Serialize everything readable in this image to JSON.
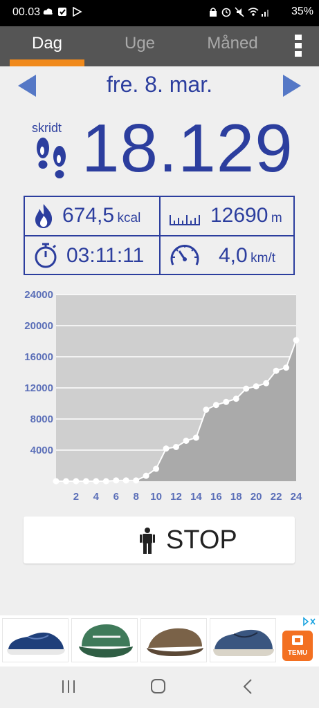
{
  "status_bar": {
    "time": "00.03",
    "battery": "35%"
  },
  "tabs": [
    {
      "label": "Dag",
      "active": true
    },
    {
      "label": "Uge",
      "active": false
    },
    {
      "label": "Måned",
      "active": false
    }
  ],
  "date": "fre. 8. mar.",
  "steps": {
    "label": "skridt",
    "value": "18.129"
  },
  "stats": {
    "calories": {
      "value": "674,5",
      "unit": "kcal"
    },
    "distance": {
      "value": "12690",
      "unit": "m"
    },
    "duration": {
      "value": "03:11:11"
    },
    "speed": {
      "value": "4,0",
      "unit": "km/t"
    }
  },
  "chart_data": {
    "type": "area",
    "ylim": [
      0,
      24000
    ],
    "xlim": [
      0,
      24
    ],
    "y_ticks": [
      "24000",
      "20000",
      "16000",
      "12000",
      "8000",
      "4000"
    ],
    "x_ticks": [
      "2",
      "4",
      "6",
      "8",
      "10",
      "12",
      "14",
      "16",
      "18",
      "20",
      "22",
      "24"
    ],
    "grid": true,
    "x": [
      0,
      1,
      2,
      3,
      4,
      5,
      6,
      7,
      8,
      9,
      10,
      11,
      12,
      13,
      14,
      15,
      16,
      17,
      18,
      19,
      20,
      21,
      22,
      23,
      24
    ],
    "values": [
      0,
      0,
      0,
      0,
      0,
      0,
      100,
      100,
      100,
      700,
      1600,
      4200,
      4400,
      5200,
      5600,
      9200,
      9800,
      10200,
      10600,
      11900,
      12200,
      12600,
      14200,
      14600,
      18129
    ],
    "colors": {
      "fill": "#aaaaaa",
      "background": "#cfcfcf",
      "line": "#ffffff",
      "points": "#ffffff",
      "tick_text": "#5b6fb8"
    }
  },
  "stop_button": {
    "label": "STOP"
  },
  "ad": {
    "brand": "TEMU"
  }
}
